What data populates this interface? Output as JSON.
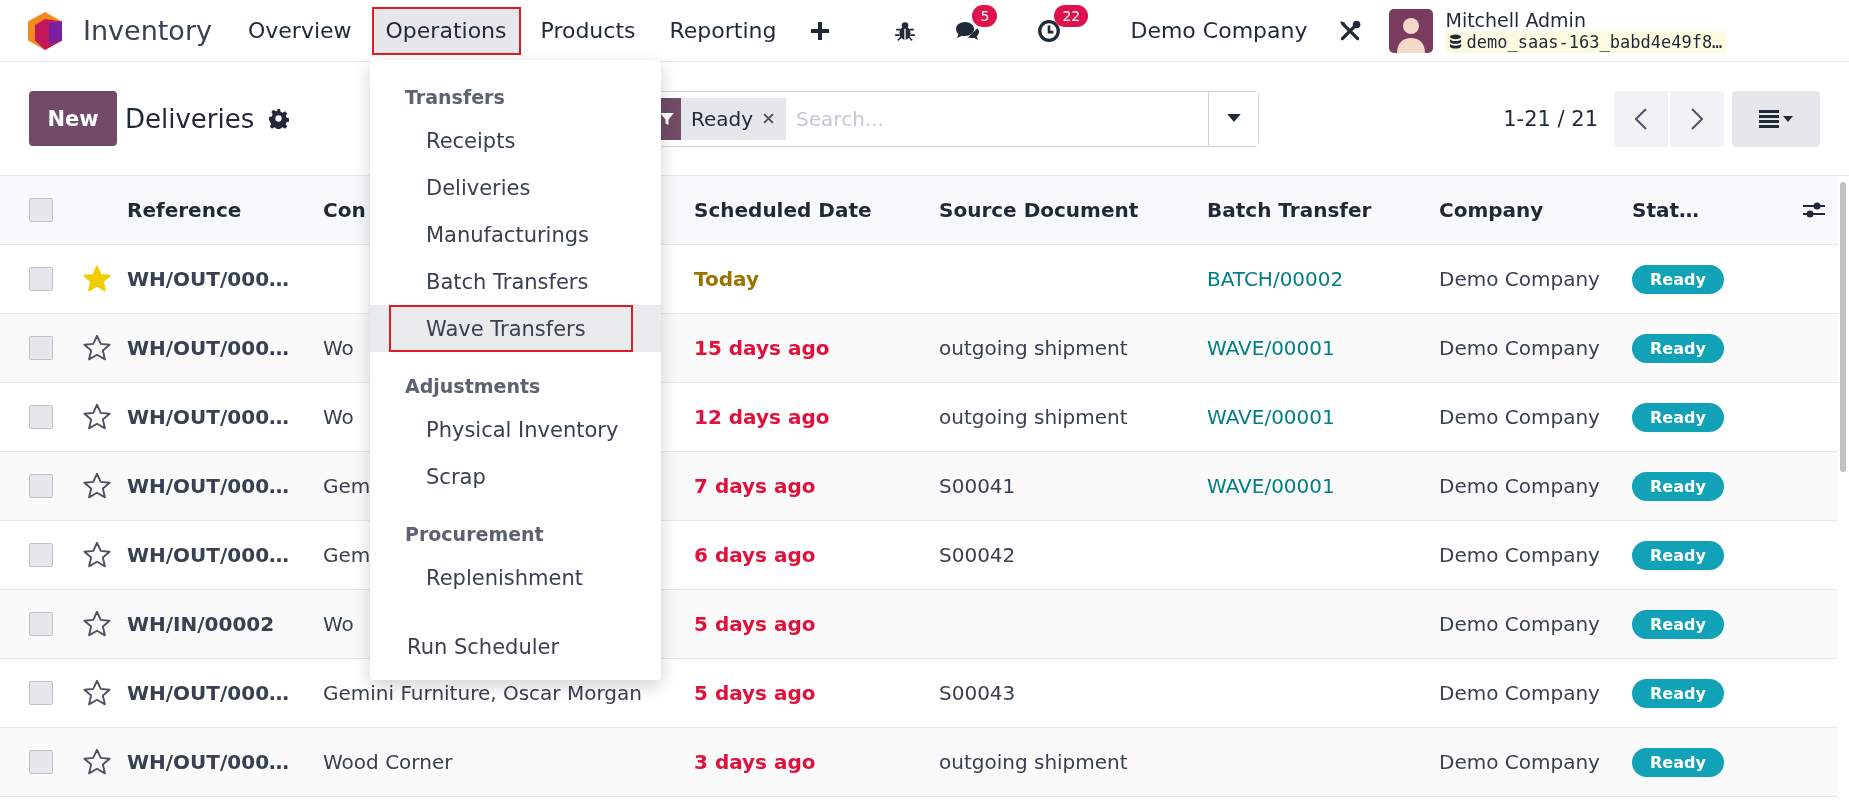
{
  "app": {
    "name": "Inventory"
  },
  "nav": [
    {
      "label": "Overview",
      "highlighted": false
    },
    {
      "label": "Operations",
      "highlighted": true
    },
    {
      "label": "Products",
      "highlighted": false
    },
    {
      "label": "Reporting",
      "highlighted": false
    }
  ],
  "systray": {
    "messages_count": "5",
    "activities_count": "22",
    "company": "Demo Company",
    "user": "Mitchell Admin",
    "database": "demo_saas-163_babd4e49f8…"
  },
  "control": {
    "new_button": "New",
    "title": "Deliveries",
    "facet": "Ready",
    "search_placeholder": "Search...",
    "pager": "1-21 / 21"
  },
  "menu": [
    {
      "kind": "header",
      "label": "Transfers"
    },
    {
      "kind": "item",
      "label": "Receipts",
      "highlighted": false
    },
    {
      "kind": "item",
      "label": "Deliveries",
      "highlighted": false
    },
    {
      "kind": "item",
      "label": "Manufacturings",
      "highlighted": false
    },
    {
      "kind": "item",
      "label": "Batch Transfers",
      "highlighted": false
    },
    {
      "kind": "item",
      "label": "Wave Transfers",
      "highlighted": true
    },
    {
      "kind": "header",
      "label": "Adjustments"
    },
    {
      "kind": "item",
      "label": "Physical Inventory",
      "highlighted": false
    },
    {
      "kind": "item",
      "label": "Scrap",
      "highlighted": false
    },
    {
      "kind": "header",
      "label": "Procurement"
    },
    {
      "kind": "item",
      "label": "Replenishment",
      "highlighted": false
    },
    {
      "kind": "action",
      "label": "Run Scheduler",
      "highlighted": false
    }
  ],
  "table": {
    "select_all_checked": false,
    "columns": [
      "Reference",
      "Con",
      "Scheduled Date",
      "Source Document",
      "Batch Transfer",
      "Company",
      "Stat…"
    ],
    "rows": [
      {
        "checked": false,
        "reference": "WH/OUT/000…",
        "starred": true,
        "date": "Today",
        "overdue": false,
        "batch": "BATCH/00002",
        "company": "Demo Company",
        "status": "Ready"
      },
      {
        "checked": false,
        "reference": "WH/OUT/000…",
        "starred": false,
        "contact": "Wo",
        "date": "15 days ago",
        "overdue": true,
        "source": "outgoing shipment",
        "batch": "WAVE/00001",
        "company": "Demo Company",
        "status": "Ready"
      },
      {
        "checked": false,
        "reference": "WH/OUT/000…",
        "starred": false,
        "contact": "Wo",
        "date": "12 days ago",
        "overdue": true,
        "source": "outgoing shipment",
        "batch": "WAVE/00001",
        "company": "Demo Company",
        "status": "Ready"
      },
      {
        "checked": false,
        "reference": "WH/OUT/000…",
        "starred": false,
        "contact": "Gem",
        "date": "7 days ago",
        "overdue": true,
        "source": "S00041",
        "batch": "WAVE/00001",
        "company": "Demo Company",
        "status": "Ready"
      },
      {
        "checked": false,
        "reference": "WH/OUT/000…",
        "starred": false,
        "contact": "Gem",
        "date": "6 days ago",
        "overdue": true,
        "source": "S00042",
        "company": "Demo Company",
        "status": "Ready"
      },
      {
        "checked": false,
        "reference": "WH/IN/00002",
        "starred": false,
        "contact": "Wo",
        "date": "5 days ago",
        "overdue": true,
        "company": "Demo Company",
        "status": "Ready"
      },
      {
        "checked": false,
        "reference": "WH/OUT/000…",
        "starred": false,
        "contact": "Gemini Furniture, Oscar Morgan",
        "date": "5 days ago",
        "overdue": true,
        "source": "S00043",
        "company": "Demo Company",
        "status": "Ready"
      },
      {
        "checked": false,
        "reference": "WH/OUT/000…",
        "starred": false,
        "contact": "Wood Corner",
        "date": "3 days ago",
        "overdue": true,
        "source": "outgoing shipment",
        "company": "Demo Company",
        "status": "Ready"
      }
    ]
  }
}
